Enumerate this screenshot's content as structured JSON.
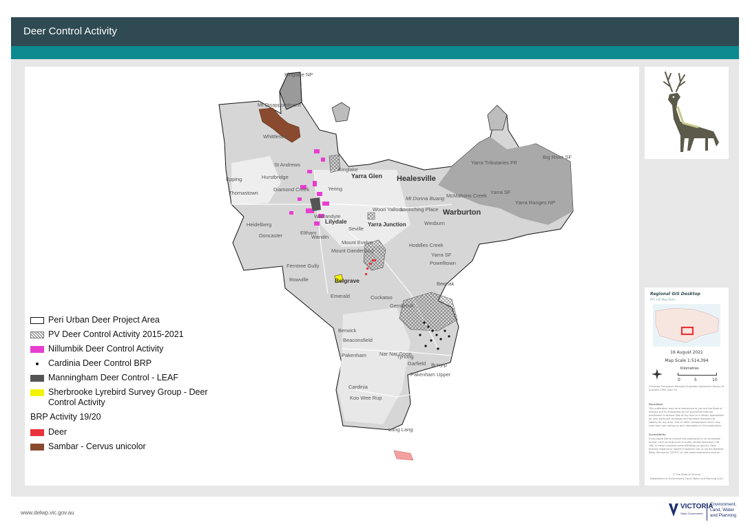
{
  "header": {
    "title": "Deer Control Activity"
  },
  "legend": {
    "items": [
      {
        "label": "Peri Urban Deer Project Area"
      },
      {
        "label": "PV Deer Control Activity 2015-2021"
      },
      {
        "label": "Nillumbik Deer Control Activity"
      },
      {
        "label": "Cardinia Deer Control BRP"
      },
      {
        "label": "Manningham Deer Control - LEAF"
      },
      {
        "label": "Sherbrooke Lyrebird Survey Group - Deer Control Activity"
      }
    ],
    "heading": "BRP Activity 19/20",
    "brp_items": [
      {
        "label": "Deer"
      },
      {
        "label": "Sambar - Cervus unicolor"
      }
    ]
  },
  "colors": {
    "header": "#2f4a52",
    "band": "#0c8a8f",
    "nillumbik": "#e83ecf",
    "manningham": "#555555",
    "sherbrooke": "#f5f20a",
    "deer": "#e8333a",
    "sambar": "#8a4a2f"
  },
  "places": {
    "kinglake": "Kinglake NP",
    "disappointment": "Mt Disappointment",
    "whittlesea": "Whittlesea",
    "st_andrews": "St Andrews",
    "hurstbridge": "Hurstbridge",
    "diamond_creek": "Diamond Creek",
    "epping": "Epping",
    "thomastown": "Thomastown",
    "yarra_glen": "Yarra Glen",
    "healesville": "Healesville",
    "mt_donna_buang": "Mt Donna Buang",
    "mcmahons": "McMahons Creek",
    "yarra_tributaries": "Yarra Tributaries FR",
    "big_river": "Big River SF",
    "yarra_sf": "Yarra SF",
    "yarra_ranges": "Yarra Ranges NP",
    "warburton": "Warburton",
    "wesburn": "Wesburn",
    "woori_yallock": "Woori Yallock",
    "launching_place": "Launching Place",
    "seville": "Seville",
    "yarra_junction": "Yarra Junction",
    "mount_evelyn": "Mount Evelyn",
    "mount_dandenong": "Mount Dandenong",
    "hoddles_creek": "Hoddles Creek",
    "yarra_sf2": "Yarra SF",
    "powelltown": "Powelltown",
    "eltham": "Eltham",
    "warrandyte": "Warrandyte",
    "heidelberg": "Heidelberg",
    "doncaster": "Doncaster",
    "ferntree_gully": "Ferntree Gully",
    "rowville": "Rowville",
    "belgrave": "Belgrave",
    "emerald": "Emerald",
    "cockatoo": "Cockatoo",
    "gembrook": "Gembrook",
    "beenak": "Beenak",
    "berwick": "Berwick",
    "beaconsfield": "Beaconsfield",
    "pakenham": "Pakenham",
    "nar_nar_goon": "Nar Nar Goon",
    "tynong": "Tynong",
    "garfield": "Garfield",
    "bunyip": "Bunyip",
    "koo_wee_rup": "Koo Wee Rup",
    "lang_lang": "Lang Lang",
    "cardinia": "Cardinia",
    "yering": "Yering",
    "pakenham_upper": "Pakenham Upper",
    "lilydale": "Lilydale",
    "kinglake2": "Kinglake",
    "wandin": "Wandin"
  },
  "scalebox": {
    "title": "Regional GIS Desktop",
    "subtitle": "PPT GIS Map Deliv",
    "date": "16 August 2021",
    "scale": "Map Scale   1:514,394",
    "km_label": "Kilometres",
    "ticks": [
      "0",
      "5",
      "10"
    ],
    "projection_note": "Universal Transverse Mercator Projection Geocentric Datum of Australia 1994 Zone 55",
    "disclaimer_title": "Disclaimer",
    "disclaimer": "This publication may be of assistance to you but the State of Victoria and its employees do not guarantee that the publication is without flaw of any kind or is wholly appropriate for your particular purposes and therefore disclaims all liability for any error, loss or other consequence which may arise from you relying on any information in this publication.",
    "accessibility_title": "Accessibility",
    "accessibility": "If you would like to receive this publication in an accessible format, such as large print or audio, please telephone 136 186, or email customer.service@delwp.vic.gov.au. Deaf, hearing impaired or speech impaired? Call us via the National Relay Service on 133 677 or visit www.relayservice.com.au",
    "copyright": "© The State of Victoria",
    "department_credit": "Department of Environment, Land, Water and Planning 2021"
  },
  "footer": {
    "url": "www.delwp.vic.gov.au",
    "logo_main": "VICTORIA",
    "logo_sub": "State Government",
    "department": [
      "Environment,",
      "Land, Water",
      "and Planning"
    ]
  }
}
